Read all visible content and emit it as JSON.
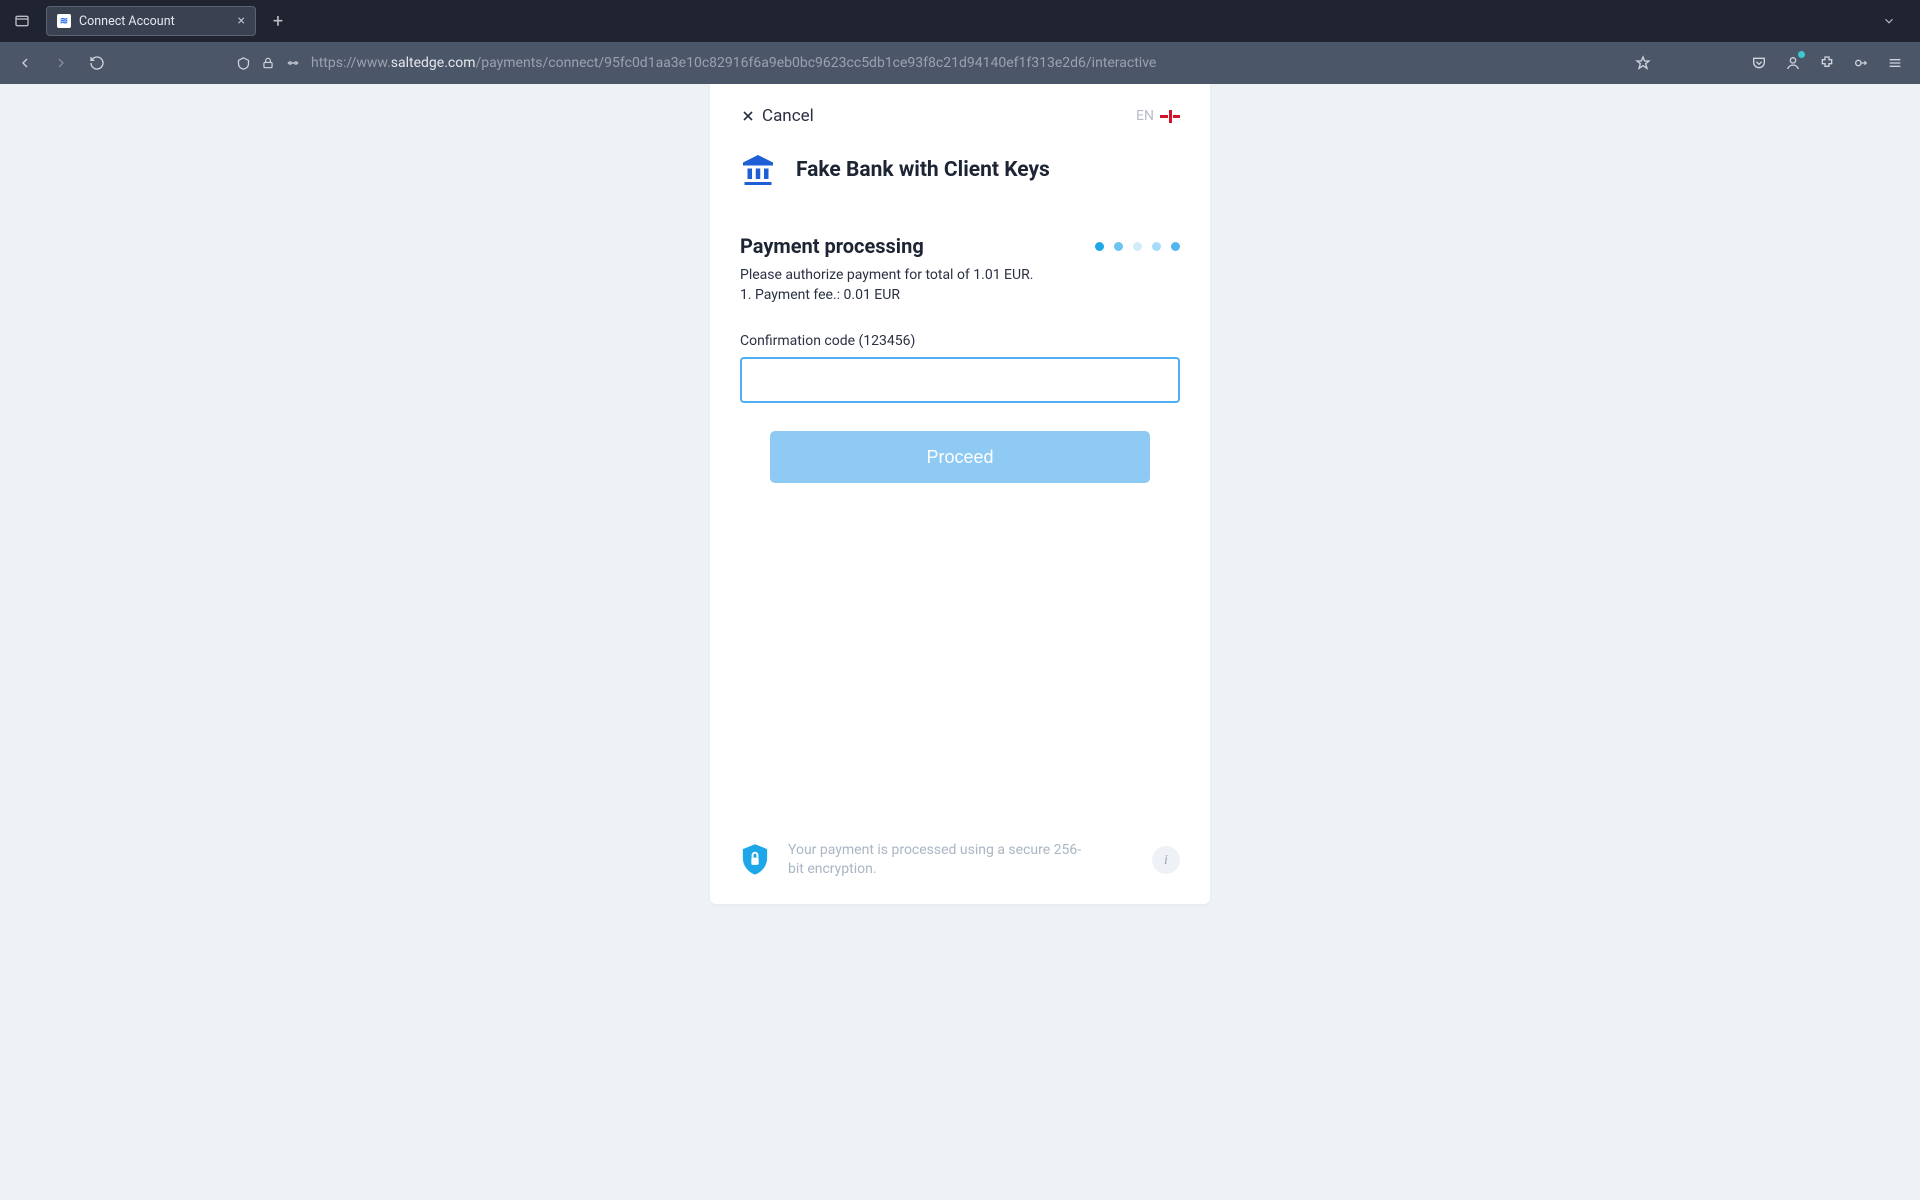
{
  "browser": {
    "tab_title": "Connect Account",
    "url_scheme": "https://www.",
    "url_host": "saltedge.com",
    "url_path": "/payments/connect/95fc0d1aa3e10c82916f6a9eb0bc9623cc5db1ce93f8c21d94140ef1f313e2d6/interactive"
  },
  "header": {
    "cancel_label": "Cancel",
    "lang_code": "EN"
  },
  "bank": {
    "name": "Fake Bank with Client Keys"
  },
  "section": {
    "title": "Payment processing",
    "line1": "Please authorize payment for total of 1.01 EUR.",
    "line2": "1. Payment fee.: 0.01 EUR"
  },
  "field": {
    "label": "Confirmation code (123456)",
    "value": ""
  },
  "actions": {
    "proceed_label": "Proceed"
  },
  "footer": {
    "text": "Your payment is processed using a secure 256-bit encryption."
  }
}
